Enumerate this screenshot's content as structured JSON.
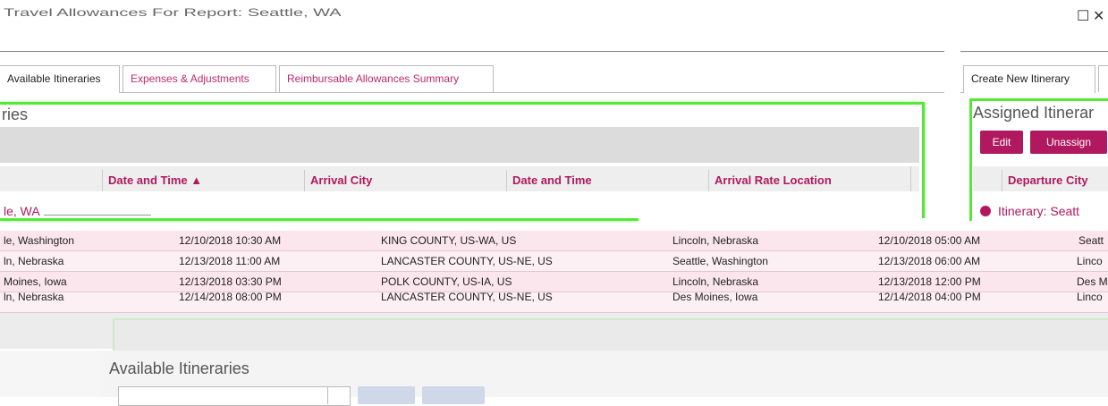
{
  "window": {
    "title": "Travel Allowances For Report: Seattle, WA",
    "close_glyph": "✕",
    "maximize_glyph": "☐"
  },
  "tabs_left": [
    {
      "label": "Available Itineraries",
      "active": true
    },
    {
      "label": "Expenses & Adjustments",
      "active": false
    },
    {
      "label": "Reimbursable Allowances Summary",
      "active": false
    }
  ],
  "tabs_right": [
    {
      "label": "Create New Itinerary",
      "active": true
    }
  ],
  "left_panel": {
    "section_title": "ries",
    "columns": [
      {
        "label": "Date and Time ▲"
      },
      {
        "label": "Arrival City"
      },
      {
        "label": "Date and Time"
      },
      {
        "label": "Arrival Rate Location"
      }
    ],
    "group_label": "le, WA",
    "rows": [
      {
        "departure_city": "le, Washington",
        "departure_datetime": "12/10/2018 10:30 AM",
        "arrival_rate_location": "KING COUNTY, US-WA, US",
        "arrival_city": "Lincoln, Nebraska",
        "arrival_datetime": "12/10/2018 05:00 AM",
        "right_city": "Seatt"
      },
      {
        "departure_city": "ln, Nebraska",
        "departure_datetime": "12/13/2018 11:00 AM",
        "arrival_rate_location": "LANCASTER COUNTY, US-NE, US",
        "arrival_city": "Seattle, Washington",
        "arrival_datetime": "12/13/2018 06:00 AM",
        "right_city": "Linco"
      },
      {
        "departure_city": "Moines, Iowa",
        "departure_datetime": "12/13/2018 03:30 PM",
        "arrival_rate_location": "POLK COUNTY, US-IA, US",
        "arrival_city": "Lincoln, Nebraska",
        "arrival_datetime": "12/13/2018 12:00 PM",
        "right_city": "Des M"
      },
      {
        "departure_city": "ln, Nebraska",
        "departure_datetime": "12/14/2018 08:00 PM",
        "arrival_rate_location": "LANCASTER COUNTY, US-NE, US",
        "arrival_city": "Des Moines, Iowa",
        "arrival_datetime": "12/14/2018 04:00 PM",
        "right_city": "Linco"
      }
    ]
  },
  "right_panel": {
    "section_title": "Assigned Itinerar",
    "edit_label": "Edit",
    "unassign_label": "Unassign",
    "column_label": "Departure City",
    "group_label": "Itinerary: Seatt"
  },
  "bottom": {
    "section_title": "Available Itineraries"
  },
  "colors": {
    "accent": "#b0195f",
    "highlight_border": "#54e839",
    "row_pink": "#fbe6ee"
  }
}
